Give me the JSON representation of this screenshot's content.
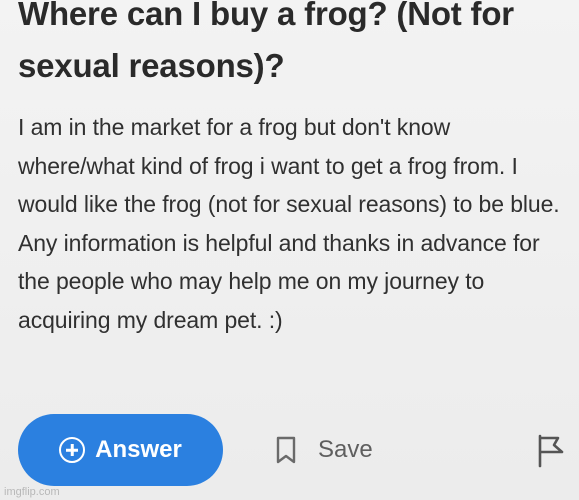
{
  "question": {
    "title": "Where can I buy a frog? (Not for sexual reasons)?",
    "body": "I am in the market for a frog but don't know where/what kind of frog i want to get a frog from. I would like the frog (not for sexual reasons) to be blue. Any information is helpful and thanks in advance for the people who may help me on my journey to acquiring my dream pet. :)"
  },
  "actions": {
    "answer_label": "Answer",
    "save_label": "Save",
    "icons": {
      "answer": "plus-circle-icon",
      "save": "bookmark-icon",
      "report": "flag-icon"
    },
    "colors": {
      "answer_bg": "#2b80e0",
      "answer_text": "#ffffff",
      "muted": "#5f5f5f"
    }
  },
  "watermark": "imgflip.com"
}
